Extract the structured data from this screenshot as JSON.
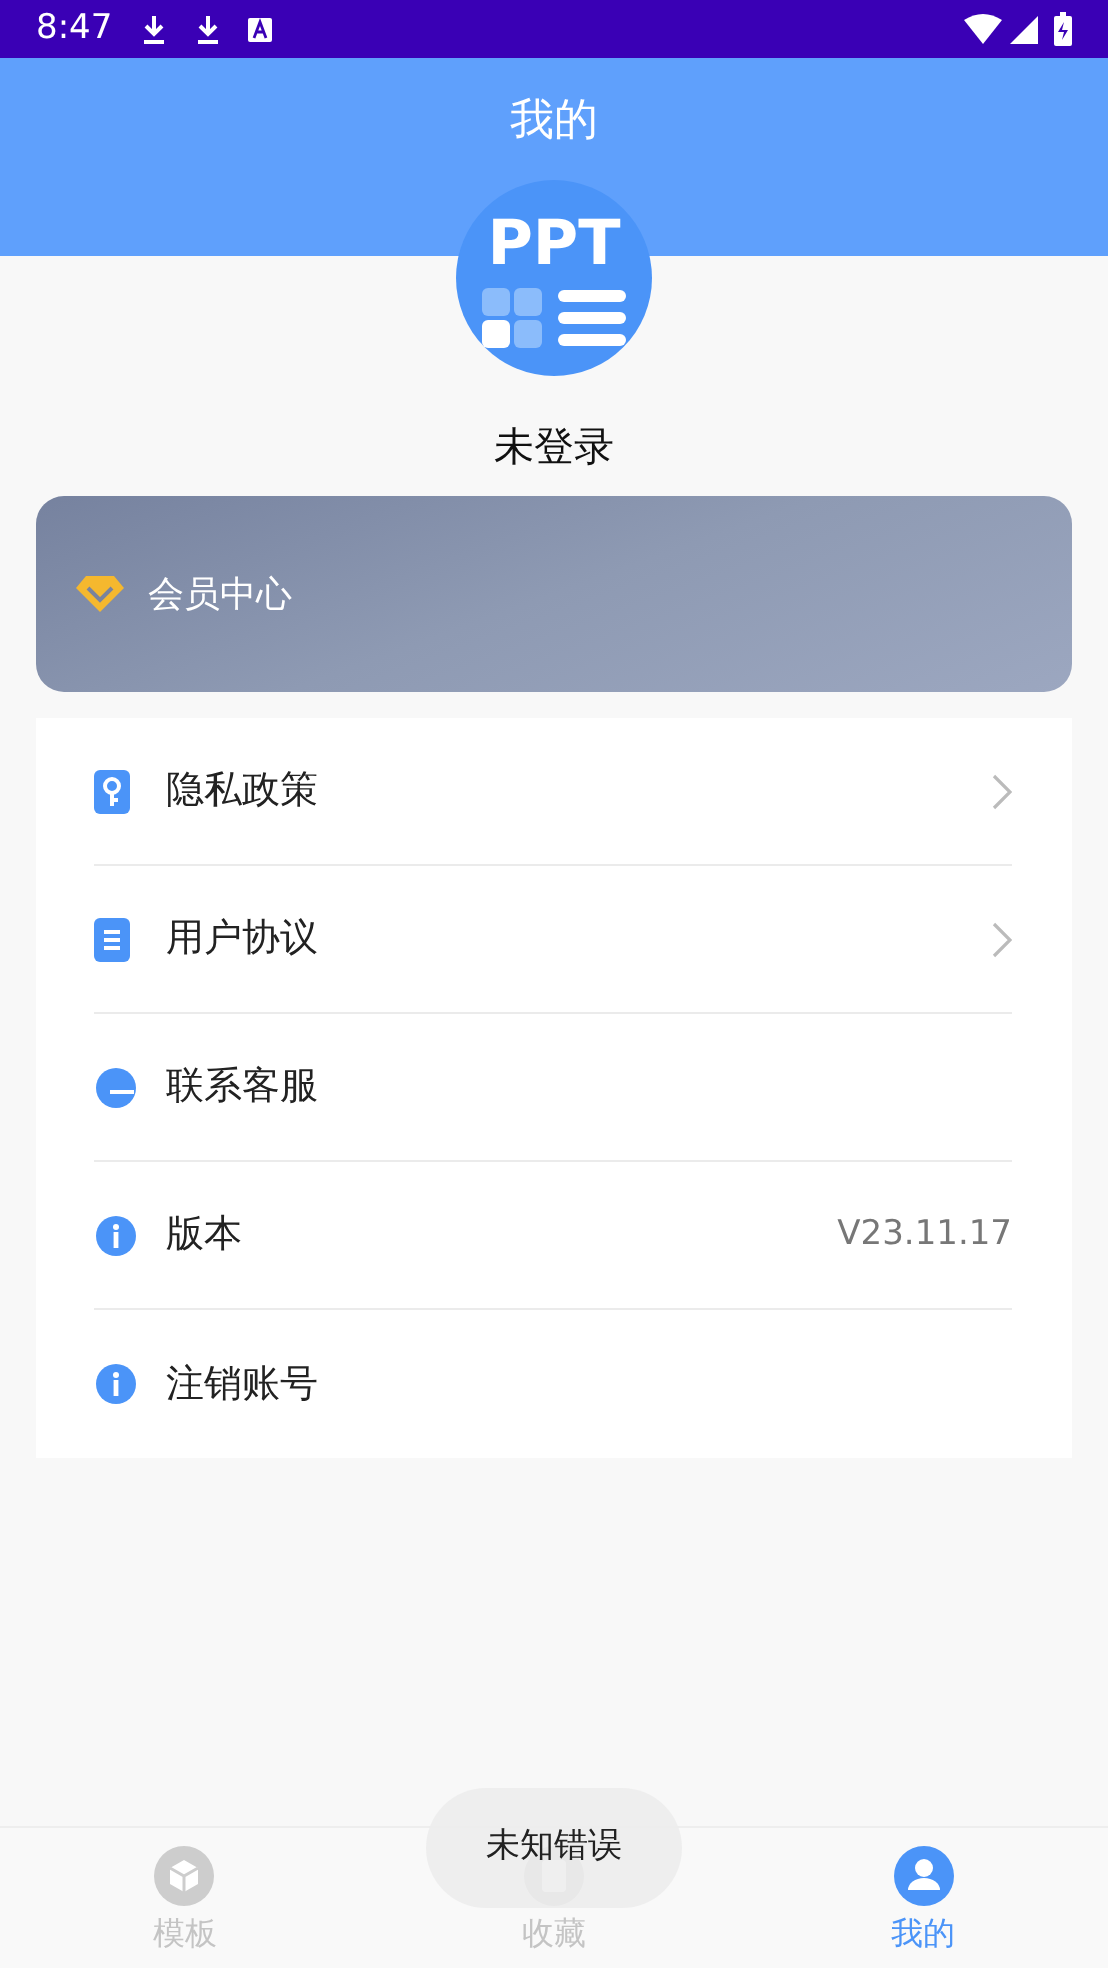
{
  "status_bar": {
    "time": "8:47"
  },
  "header": {
    "title": "我的"
  },
  "profile": {
    "logo_text": "PPT",
    "name": "未登录"
  },
  "member_card": {
    "label": "会员中心"
  },
  "menu": [
    {
      "kind": "key",
      "label": "隐私政策",
      "chevron": true
    },
    {
      "kind": "document",
      "label": "用户协议",
      "chevron": true
    },
    {
      "kind": "chat",
      "label": "联系客服",
      "chevron": false
    },
    {
      "kind": "info",
      "label": "版本",
      "value": "V23.11.17",
      "chevron": false
    },
    {
      "kind": "info",
      "label": "注销账号",
      "chevron": false
    }
  ],
  "toast": {
    "text": "未知错误"
  },
  "tabs": [
    {
      "kind": "cube",
      "label": "模板",
      "selected": false
    },
    {
      "kind": "document",
      "label": "收藏",
      "selected": false
    },
    {
      "kind": "person",
      "label": "我的",
      "selected": true
    }
  ]
}
